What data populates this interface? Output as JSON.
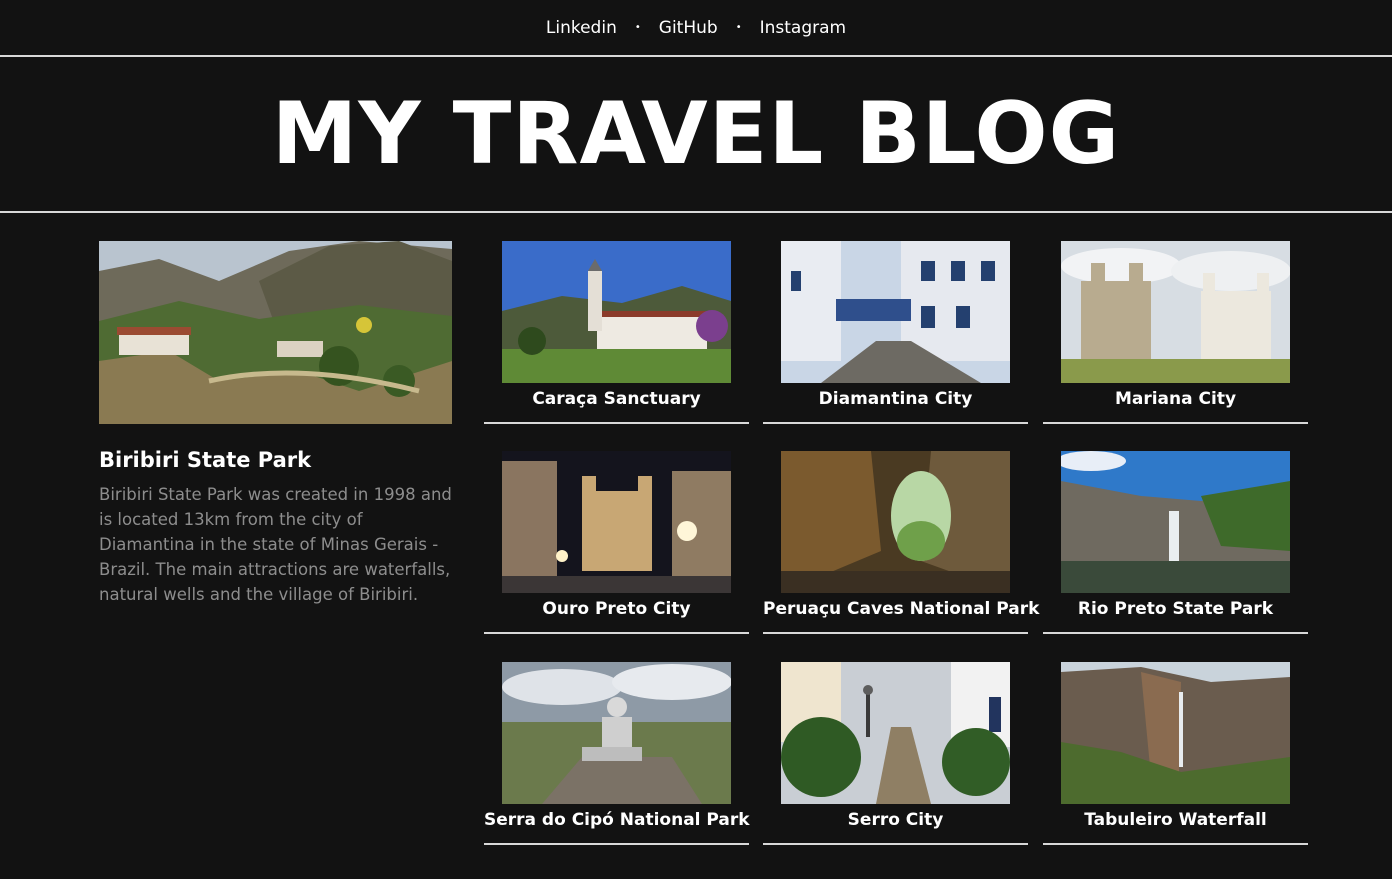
{
  "nav": {
    "links": [
      "Linkedin",
      "GitHub",
      "Instagram"
    ],
    "separator": "•"
  },
  "header": {
    "title": "MY TRAVEL BLOG"
  },
  "featured": {
    "title": "Biribiri State Park",
    "description": "Biribiri State Park was created in 1998 and is located 13km from the city of Diamantina in the state of Minas Gerais - Brazil. The main attractions are waterfalls, natural wells and the village of Biribiri."
  },
  "cards": [
    {
      "title": "Caraça Sanctuary"
    },
    {
      "title": "Diamantina City"
    },
    {
      "title": "Mariana City"
    },
    {
      "title": "Ouro Preto City"
    },
    {
      "title": "Peruaçu Caves National Park"
    },
    {
      "title": "Rio Preto State Park"
    },
    {
      "title": "Serra do Cipó National Park"
    },
    {
      "title": "Serro City"
    },
    {
      "title": "Tabuleiro Waterfall"
    }
  ],
  "colors": {
    "background": "#121212",
    "text": "#ffffff",
    "muted_text": "#8d8d8d",
    "rule": "#d8d8d8"
  }
}
